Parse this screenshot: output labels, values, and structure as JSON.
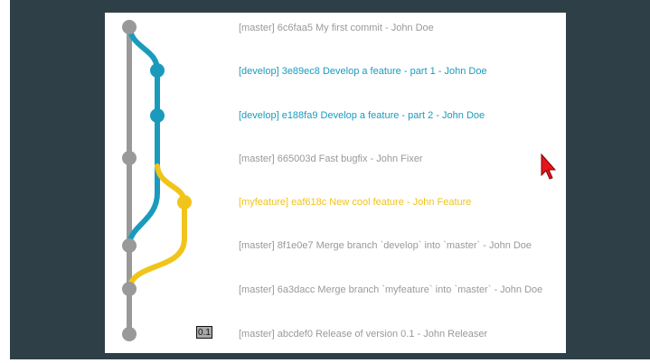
{
  "colors": {
    "background": "#2f3f47",
    "panel": "#ffffff",
    "master": "#999999",
    "develop": "#1a9bbd",
    "myfeature": "#f0c419",
    "cursor": "#e8141c"
  },
  "commits": [
    {
      "branch": "master",
      "text": "[master] 6c6faa5 My first commit - John Doe"
    },
    {
      "branch": "develop",
      "text": "[develop] 3e89ec8 Develop a feature - part 1 - John Doe"
    },
    {
      "branch": "develop",
      "text": "[develop] e188fa9 Develop a feature - part 2 - John Doe"
    },
    {
      "branch": "master",
      "text": "[master] 665003d Fast bugfix - John Fixer"
    },
    {
      "branch": "myfeature",
      "text": "[myfeature] eaf618c New cool feature - John Feature"
    },
    {
      "branch": "master",
      "text": "[master] 8f1e0e7 Merge branch `develop` into `master` - John Doe"
    },
    {
      "branch": "master",
      "text": "[master] 6a3dacc Merge branch `myfeature` into `master` - John Doe"
    },
    {
      "branch": "master",
      "text": "[master] abcdef0 Release of version 0.1 - John Releaser"
    }
  ],
  "tag": {
    "label": "0.1"
  },
  "icons": {
    "cursor": "mouse-pointer-icon"
  }
}
